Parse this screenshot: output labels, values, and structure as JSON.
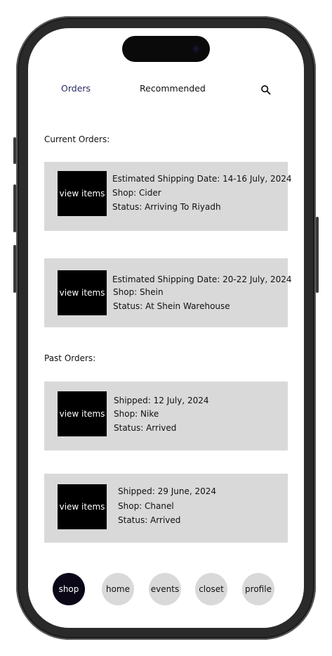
{
  "top_nav": {
    "tabs": [
      {
        "label": "Orders",
        "active": true
      },
      {
        "label": "Recommended",
        "active": false
      }
    ],
    "search_icon": "search-icon"
  },
  "current_orders": {
    "heading": "Current Orders:",
    "orders": [
      {
        "button": "view items",
        "shipping": "Estimated Shipping Date: 14-16 July, 2024",
        "shop": "Shop: Cider",
        "status": "Status: Arriving To Riyadh"
      },
      {
        "button": "view items",
        "shipping": "Estimated Shipping Date: 20-22 July, 2024",
        "shop": "Shop: Shein",
        "status": "Status: At Shein Warehouse"
      }
    ]
  },
  "past_orders": {
    "heading": "Past Orders:",
    "orders": [
      {
        "button": "view items",
        "shipping": "Shipped: 12 July, 2024",
        "shop": "Shop: Nike",
        "status": "Status: Arrived"
      },
      {
        "button": "view items",
        "shipping": "Shipped: 29 June, 2024",
        "shop": "Shop: Chanel",
        "status": "Status: Arrived"
      }
    ]
  },
  "bottom_nav": {
    "items": [
      {
        "label": "shop",
        "active": true
      },
      {
        "label": "home",
        "active": false
      },
      {
        "label": "events",
        "active": false
      },
      {
        "label": "closet",
        "active": false
      },
      {
        "label": "profile",
        "active": false
      }
    ]
  },
  "colors": {
    "card_bg": "#d9d9d9",
    "active_tab": "#2b2a66",
    "active_nav": "#0b0717",
    "button_bg": "#000000"
  }
}
